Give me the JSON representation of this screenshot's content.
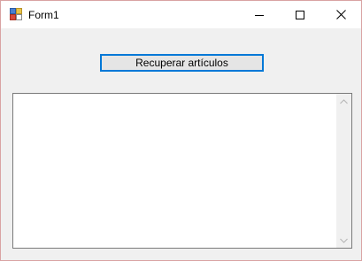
{
  "window": {
    "title": "Form1"
  },
  "main": {
    "button_label": "Recuperar artículos",
    "textarea_value": ""
  }
}
